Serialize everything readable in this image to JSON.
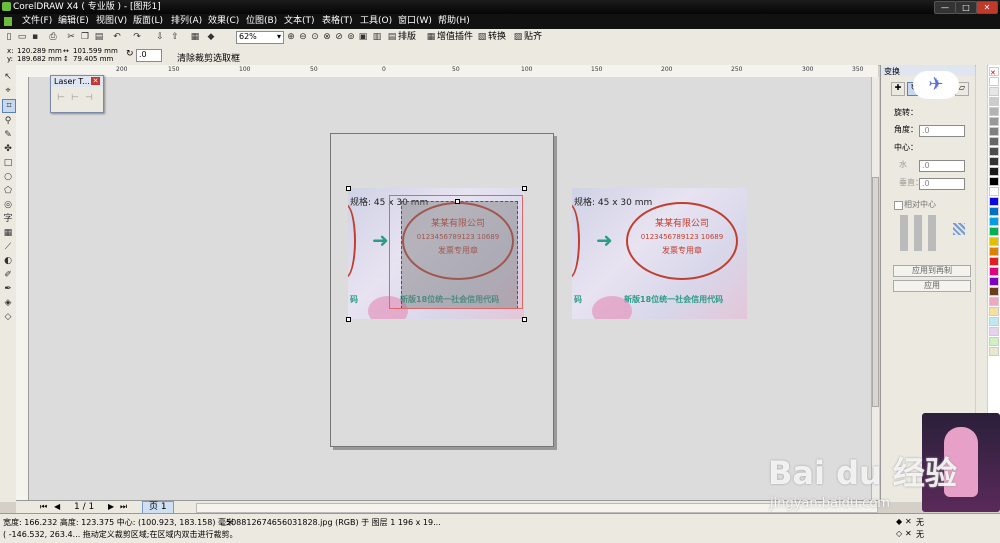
{
  "window": {
    "title": "CorelDRAW X4 ( 专业版 ) - [图形1]"
  },
  "menu": [
    "文件(F)",
    "编辑(E)",
    "视图(V)",
    "版面(L)",
    "排列(A)",
    "效果(C)",
    "位图(B)",
    "文本(T)",
    "表格(T)",
    "工具(O)",
    "窗口(W)",
    "帮助(H)"
  ],
  "toolbar": {
    "zoom": "62%",
    "labels": [
      "排版",
      "增值插件",
      "转换",
      "贴齐"
    ]
  },
  "propbar": {
    "x": "120.289 mm",
    "y": "189.682 mm",
    "w": "101.599 mm",
    "h": "79.405 mm",
    "angle": ".0",
    "hint": "清除裁剪选取框"
  },
  "ruler": {
    "top": [
      "200",
      "150",
      "100",
      "50",
      "0",
      "50",
      "100",
      "150",
      "200",
      "250",
      "300",
      "350"
    ]
  },
  "float_window": {
    "title": "Laser T..."
  },
  "page_content": {
    "spec": "规格: 45 x 30 mm",
    "stamp_lines": [
      "某某有限公司",
      "0123456789123 10689",
      "发票专用章"
    ],
    "bottom_text": "新版18位统一社会信用代码",
    "side_text": "码"
  },
  "docker": {
    "title": "变换",
    "rotate_label": "旋转：",
    "angle_label": "角度：",
    "angle_value": ".0",
    "center_label": "中心：",
    "h_label": "水",
    "h_value": ".0",
    "v_label": "垂直：",
    "v_value": ".0",
    "relative_center": "相对中心",
    "apply_copy": "应用到再制",
    "apply": "应用"
  },
  "page_nav": {
    "counter": "1 / 1",
    "tab": "页 1"
  },
  "status": {
    "line1": "宽度: 166.232  高度: 123.375  中心: (100.923, 183.158)  毫米",
    "file": "508812674656031828.jpg (RGB) 于 图层 1 196 x 19...",
    "line2": "( -146.532, 263.4...  拖动定义裁剪区域;在区域内双击进行裁剪。",
    "fill1": "无",
    "fill2": "无"
  },
  "watermark": {
    "brand": "Bai du 经验",
    "url": "jingyan.baidu.com"
  },
  "colors": {
    "accent": "#2a9c88",
    "stamp": "#c03f30",
    "titlebar": "#111111"
  }
}
